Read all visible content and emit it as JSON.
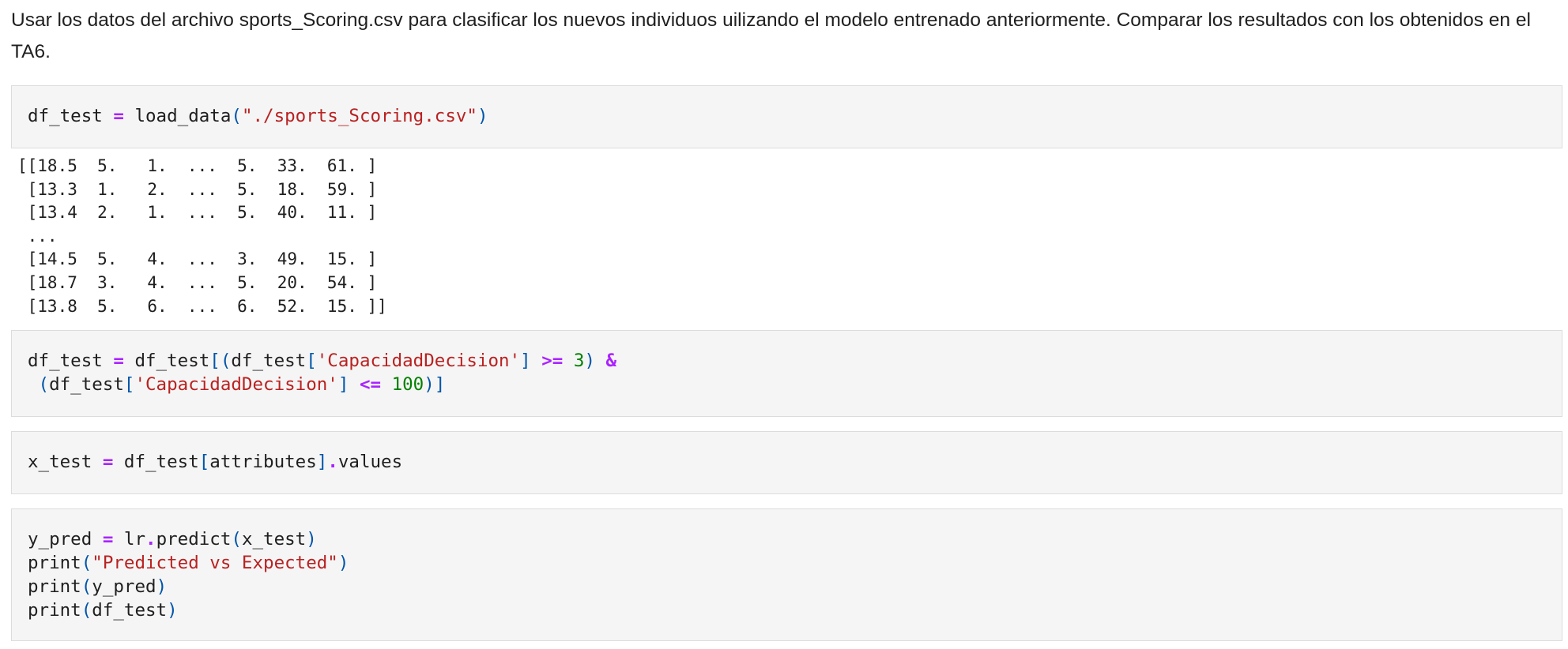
{
  "markdown": {
    "text": "Usar los datos del archivo sports_Scoring.csv para clasificar los nuevos individuos uilizando el modelo entrenado anteriormente. Comparar los resultados con los obtenidos en el TA6."
  },
  "cell1": {
    "var": "df_test",
    "eq": "=",
    "func": "load_data",
    "lparen": "(",
    "arg": "\"./sports_Scoring.csv\"",
    "rparen": ")"
  },
  "output1": {
    "lines": [
      "[[18.5  5.   1.  ...  5.  33.  61. ]",
      " [13.3  1.   2.  ...  5.  18.  59. ]",
      " [13.4  2.   1.  ...  5.  40.  11. ]",
      " ...",
      " [14.5  5.   4.  ...  3.  49.  15. ]",
      " [18.7  3.   4.  ...  5.  20.  54. ]",
      " [13.8  5.   6.  ...  6.  52.  15. ]]"
    ]
  },
  "cell2": {
    "l1_var": "df_test",
    "l1_eq": "=",
    "l1_a": "df_test",
    "l1_b": "[(",
    "l1_c": "df_test",
    "l1_d": "[",
    "l1_str": "'CapacidadDecision'",
    "l1_e": "]",
    "l1_op": ">=",
    "l1_num": "3",
    "l1_f": ")",
    "l1_amp": "&",
    "l2_a": " (",
    "l2_b": "df_test",
    "l2_c": "[",
    "l2_str": "'CapacidadDecision'",
    "l2_d": "]",
    "l2_op": "<=",
    "l2_num": "100",
    "l2_e": ")]"
  },
  "cell3": {
    "var": "x_test",
    "eq": "=",
    "a": "df_test",
    "b": "[",
    "c": "attributes",
    "d": "]",
    "dot": ".",
    "e": "values"
  },
  "cell4": {
    "l1_var": "y_pred",
    "l1_eq": "=",
    "l1_a": "lr",
    "l1_dot": ".",
    "l1_b": "predict",
    "l1_c": "(",
    "l1_d": "x_test",
    "l1_e": ")",
    "l2_a": "print",
    "l2_b": "(",
    "l2_str": "\"Predicted vs Expected\"",
    "l2_c": ")",
    "l3_a": "print",
    "l3_b": "(",
    "l3_c": "y_pred",
    "l3_d": ")",
    "l4_a": "print",
    "l4_b": "(",
    "l4_c": "df_test",
    "l4_d": ")"
  },
  "colors": {
    "operator": "#aa22ff",
    "punctuation": "#0055aa",
    "string": "#ba2121",
    "number": "#008000",
    "cell_background": "#f5f5f5"
  }
}
